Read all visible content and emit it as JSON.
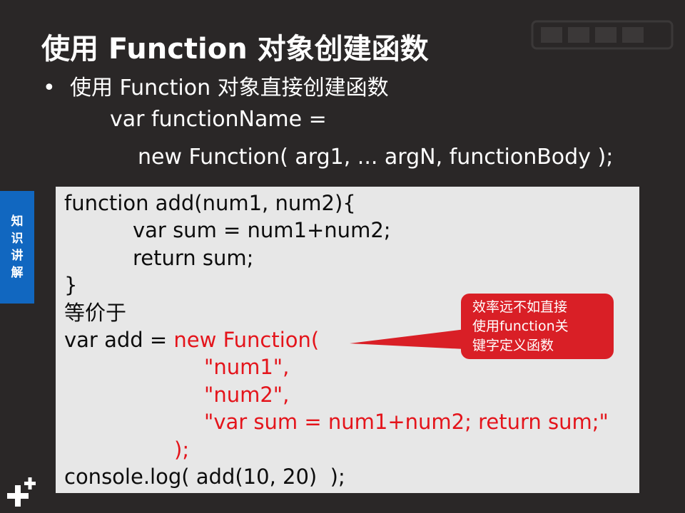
{
  "slide": {
    "title": "使用 Function 对象创建函数",
    "bullet_mark": "•",
    "bullet_text": "使用 Function 对象直接创建函数",
    "syntax_line1": "var functionName =",
    "syntax_line2": "new Function( arg1, ... argN, functionBody );",
    "side_tab": [
      "知",
      "识",
      "讲",
      "解"
    ],
    "code_lines": [
      {
        "indent": 0,
        "black": "function add(num1, num2){",
        "red": ""
      },
      {
        "indent": 96,
        "black": "var sum = num1+num2;",
        "red": ""
      },
      {
        "indent": 96,
        "black": "return sum;",
        "red": ""
      },
      {
        "indent": 0,
        "black": "}",
        "red": ""
      },
      {
        "indent": 0,
        "black": "等价于",
        "red": ""
      },
      {
        "indent": 0,
        "black": "var add = ",
        "red": "new Function("
      },
      {
        "indent": 196,
        "black": "",
        "red": "\"num1\","
      },
      {
        "indent": 196,
        "black": "",
        "red": "\"num2\","
      },
      {
        "indent": 196,
        "black": "",
        "red": "\"var sum = num1+num2; return sum;\""
      },
      {
        "indent": 154,
        "black": "",
        "red": ");"
      },
      {
        "indent": 0,
        "black": "console.log( add(10, 20)  );",
        "red": ""
      }
    ],
    "callout_lines": [
      "效率远不如直接",
      "使用function关",
      "键字定义函数"
    ],
    "colors": {
      "background": "#2a2727",
      "code_bg": "#e7e7e7",
      "accent_red": "#e4141b",
      "callout_red": "#d91f26",
      "side_tab_blue": "#1167c0"
    }
  }
}
